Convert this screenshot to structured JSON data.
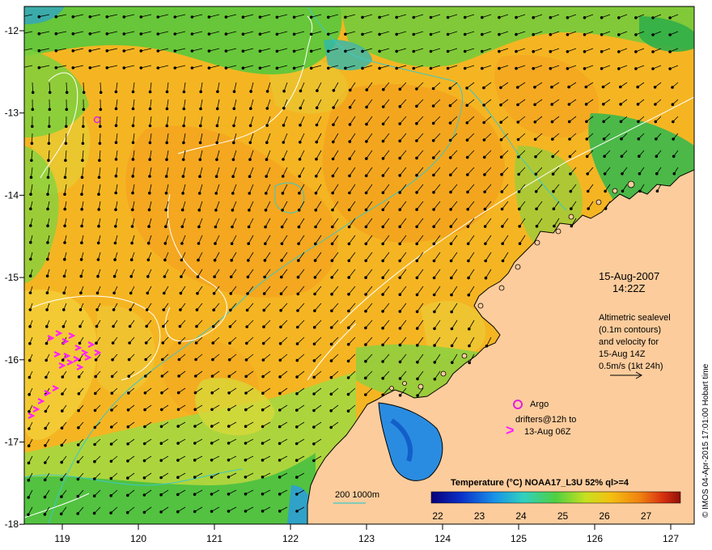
{
  "date_label": "15-Aug-2007",
  "time_label": "14:22Z",
  "legend_text": [
    "Altimetric sealevel",
    "(0.1m contours)",
    "and velocity for",
    "15-Aug 14Z",
    "0.5m/s (1kt 24h)"
  ],
  "argo_label": "Argo",
  "drifters_text": [
    "drifters@12h to",
    "13-Aug 06Z"
  ],
  "colorbar_title": "Temperature (°C) NOAA17_L3U 52% ql>=4",
  "colorbar_ticks": [
    "22",
    "23",
    "24",
    "25",
    "26",
    "27"
  ],
  "depth_legend": "200  1000m",
  "credit": "© IMOS 04-Apr-2015 17:01:00 Hobart time",
  "x_ticks": [
    "119",
    "120",
    "121",
    "122",
    "123",
    "124",
    "125",
    "126",
    "127"
  ],
  "y_ticks": [
    "-12",
    "-13",
    "-14",
    "-15",
    "-16",
    "-17",
    "-18"
  ],
  "colors": {
    "land": "#fccc9c",
    "coast": "#000000",
    "isobath": "#3cc8c8",
    "contour": "#ffffff",
    "argo": "#e020e0",
    "drifter": "#ff20ff"
  }
}
